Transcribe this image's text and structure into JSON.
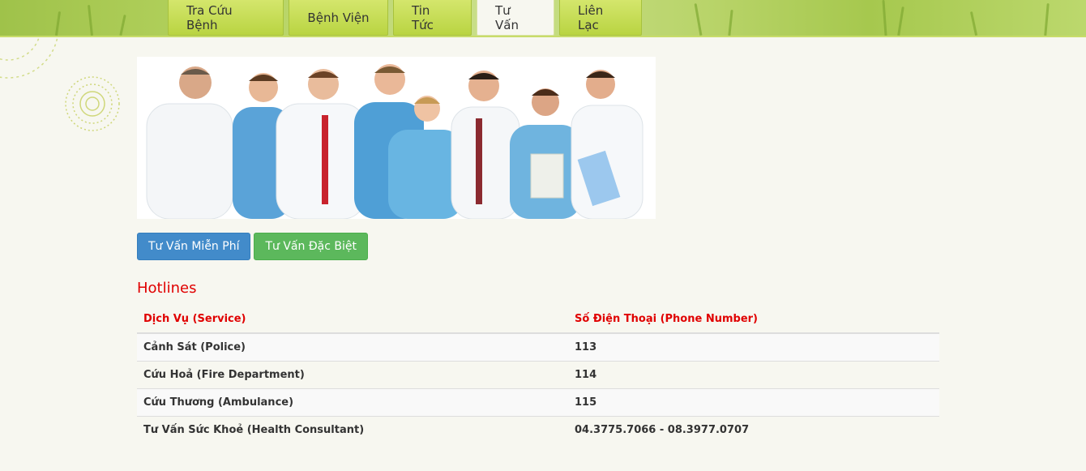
{
  "nav": {
    "tabs": [
      {
        "label": "Tra Cứu Bệnh"
      },
      {
        "label": "Bệnh Viện"
      },
      {
        "label": "Tin Tức"
      },
      {
        "label": "Tư Vấn"
      },
      {
        "label": "Liên Lạc"
      }
    ],
    "active_tab": "Tư Vấn"
  },
  "hero": {
    "icon": "medical-team-photo"
  },
  "buttons": {
    "free_consult": "Tư Vấn Miễn Phí",
    "special_consult": "Tư Vấn Đặc Biệt"
  },
  "hotlines": {
    "title": "Hotlines",
    "headers": [
      "Dịch Vụ (Service)",
      "Số Điện Thoại (Phone Number)"
    ],
    "rows": [
      [
        "Cảnh Sát (Police)",
        "113"
      ],
      [
        "Cứu Hoả (Fire Department)",
        "114"
      ],
      [
        "Cứu Thương (Ambulance)",
        "115"
      ],
      [
        "Tư Vấn Sức Khoẻ (Health Consultant)",
        "04.3775.7066 - 08.3977.0707"
      ]
    ]
  },
  "colors": {
    "accent_red": "#e00000",
    "primary_button": "#428bca",
    "success_button": "#5cb85c",
    "banner_green": "#b4d25e"
  }
}
